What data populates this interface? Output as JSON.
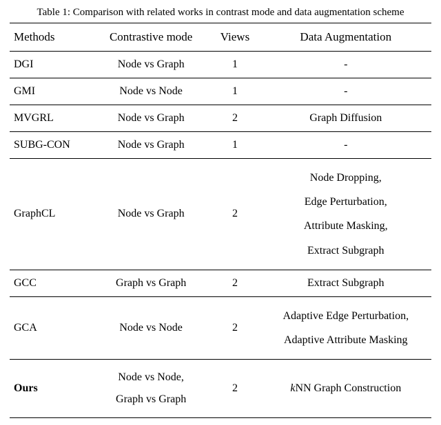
{
  "caption": "Table 1: Comparison with related works in contrast mode and data augmentation scheme",
  "headers": [
    "Methods",
    "Contrastive mode",
    "Views",
    "Data Augmentation"
  ],
  "rows": [
    {
      "method": "DGI",
      "mode": "Node vs Graph",
      "views": "1",
      "aug": "-"
    },
    {
      "method": "GMI",
      "mode": "Node vs Node",
      "views": "1",
      "aug": "-"
    },
    {
      "method": "MVGRL",
      "mode": "Node vs Graph",
      "views": "2",
      "aug": "Graph Diffusion"
    },
    {
      "method": "SUBG-CON",
      "mode": "Node vs Graph",
      "views": "1",
      "aug": "-"
    },
    {
      "method": "GraphCL",
      "mode": "Node vs Graph",
      "views": "2",
      "aug_lines": [
        "Node Dropping,",
        "Edge Perturbation,",
        "Attribute Masking,",
        "Extract Subgraph"
      ]
    },
    {
      "method": "GCC",
      "mode": "Graph vs Graph",
      "views": "2",
      "aug": "Extract Subgraph"
    },
    {
      "method": "GCA",
      "mode": "Node vs Node",
      "views": "2",
      "aug_lines": [
        "Adaptive Edge Perturbation,",
        "Adaptive Attribute Masking"
      ]
    },
    {
      "method": "Ours",
      "mode_lines": [
        "Node vs Node,",
        "Graph vs Graph"
      ],
      "views": "2",
      "aug_k": "k",
      "aug_rest": "NN Graph Construction",
      "bold_method": true
    }
  ],
  "chart_data": {
    "type": "table",
    "title": "Comparison with related works in contrast mode and data augmentation scheme",
    "columns": [
      "Methods",
      "Contrastive mode",
      "Views",
      "Data Augmentation"
    ],
    "rows": [
      [
        "DGI",
        "Node vs Graph",
        1,
        "-"
      ],
      [
        "GMI",
        "Node vs Node",
        1,
        "-"
      ],
      [
        "MVGRL",
        "Node vs Graph",
        2,
        "Graph Diffusion"
      ],
      [
        "SUBG-CON",
        "Node vs Graph",
        1,
        "-"
      ],
      [
        "GraphCL",
        "Node vs Graph",
        2,
        "Node Dropping, Edge Perturbation, Attribute Masking, Extract Subgraph"
      ],
      [
        "GCC",
        "Graph vs Graph",
        2,
        "Extract Subgraph"
      ],
      [
        "GCA",
        "Node vs Node",
        2,
        "Adaptive Edge Perturbation, Adaptive Attribute Masking"
      ],
      [
        "Ours",
        "Node vs Node, Graph vs Graph",
        2,
        "kNN Graph Construction"
      ]
    ]
  }
}
